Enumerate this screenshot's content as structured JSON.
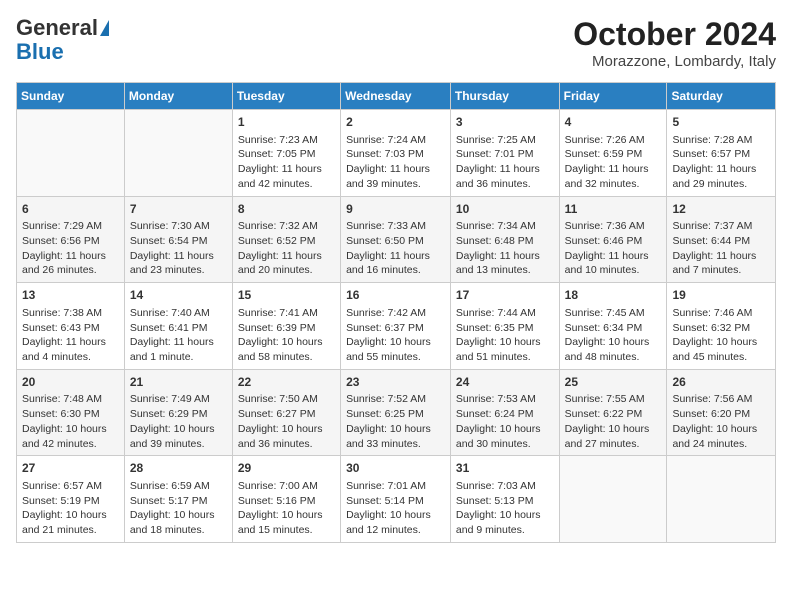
{
  "logo": {
    "line1": "General",
    "line2": "Blue"
  },
  "title": "October 2024",
  "subtitle": "Morazzone, Lombardy, Italy",
  "weekdays": [
    "Sunday",
    "Monday",
    "Tuesday",
    "Wednesday",
    "Thursday",
    "Friday",
    "Saturday"
  ],
  "weeks": [
    [
      {
        "day": "",
        "content": ""
      },
      {
        "day": "",
        "content": ""
      },
      {
        "day": "1",
        "content": "Sunrise: 7:23 AM\nSunset: 7:05 PM\nDaylight: 11 hours and 42 minutes."
      },
      {
        "day": "2",
        "content": "Sunrise: 7:24 AM\nSunset: 7:03 PM\nDaylight: 11 hours and 39 minutes."
      },
      {
        "day": "3",
        "content": "Sunrise: 7:25 AM\nSunset: 7:01 PM\nDaylight: 11 hours and 36 minutes."
      },
      {
        "day": "4",
        "content": "Sunrise: 7:26 AM\nSunset: 6:59 PM\nDaylight: 11 hours and 32 minutes."
      },
      {
        "day": "5",
        "content": "Sunrise: 7:28 AM\nSunset: 6:57 PM\nDaylight: 11 hours and 29 minutes."
      }
    ],
    [
      {
        "day": "6",
        "content": "Sunrise: 7:29 AM\nSunset: 6:56 PM\nDaylight: 11 hours and 26 minutes."
      },
      {
        "day": "7",
        "content": "Sunrise: 7:30 AM\nSunset: 6:54 PM\nDaylight: 11 hours and 23 minutes."
      },
      {
        "day": "8",
        "content": "Sunrise: 7:32 AM\nSunset: 6:52 PM\nDaylight: 11 hours and 20 minutes."
      },
      {
        "day": "9",
        "content": "Sunrise: 7:33 AM\nSunset: 6:50 PM\nDaylight: 11 hours and 16 minutes."
      },
      {
        "day": "10",
        "content": "Sunrise: 7:34 AM\nSunset: 6:48 PM\nDaylight: 11 hours and 13 minutes."
      },
      {
        "day": "11",
        "content": "Sunrise: 7:36 AM\nSunset: 6:46 PM\nDaylight: 11 hours and 10 minutes."
      },
      {
        "day": "12",
        "content": "Sunrise: 7:37 AM\nSunset: 6:44 PM\nDaylight: 11 hours and 7 minutes."
      }
    ],
    [
      {
        "day": "13",
        "content": "Sunrise: 7:38 AM\nSunset: 6:43 PM\nDaylight: 11 hours and 4 minutes."
      },
      {
        "day": "14",
        "content": "Sunrise: 7:40 AM\nSunset: 6:41 PM\nDaylight: 11 hours and 1 minute."
      },
      {
        "day": "15",
        "content": "Sunrise: 7:41 AM\nSunset: 6:39 PM\nDaylight: 10 hours and 58 minutes."
      },
      {
        "day": "16",
        "content": "Sunrise: 7:42 AM\nSunset: 6:37 PM\nDaylight: 10 hours and 55 minutes."
      },
      {
        "day": "17",
        "content": "Sunrise: 7:44 AM\nSunset: 6:35 PM\nDaylight: 10 hours and 51 minutes."
      },
      {
        "day": "18",
        "content": "Sunrise: 7:45 AM\nSunset: 6:34 PM\nDaylight: 10 hours and 48 minutes."
      },
      {
        "day": "19",
        "content": "Sunrise: 7:46 AM\nSunset: 6:32 PM\nDaylight: 10 hours and 45 minutes."
      }
    ],
    [
      {
        "day": "20",
        "content": "Sunrise: 7:48 AM\nSunset: 6:30 PM\nDaylight: 10 hours and 42 minutes."
      },
      {
        "day": "21",
        "content": "Sunrise: 7:49 AM\nSunset: 6:29 PM\nDaylight: 10 hours and 39 minutes."
      },
      {
        "day": "22",
        "content": "Sunrise: 7:50 AM\nSunset: 6:27 PM\nDaylight: 10 hours and 36 minutes."
      },
      {
        "day": "23",
        "content": "Sunrise: 7:52 AM\nSunset: 6:25 PM\nDaylight: 10 hours and 33 minutes."
      },
      {
        "day": "24",
        "content": "Sunrise: 7:53 AM\nSunset: 6:24 PM\nDaylight: 10 hours and 30 minutes."
      },
      {
        "day": "25",
        "content": "Sunrise: 7:55 AM\nSunset: 6:22 PM\nDaylight: 10 hours and 27 minutes."
      },
      {
        "day": "26",
        "content": "Sunrise: 7:56 AM\nSunset: 6:20 PM\nDaylight: 10 hours and 24 minutes."
      }
    ],
    [
      {
        "day": "27",
        "content": "Sunrise: 6:57 AM\nSunset: 5:19 PM\nDaylight: 10 hours and 21 minutes."
      },
      {
        "day": "28",
        "content": "Sunrise: 6:59 AM\nSunset: 5:17 PM\nDaylight: 10 hours and 18 minutes."
      },
      {
        "day": "29",
        "content": "Sunrise: 7:00 AM\nSunset: 5:16 PM\nDaylight: 10 hours and 15 minutes."
      },
      {
        "day": "30",
        "content": "Sunrise: 7:01 AM\nSunset: 5:14 PM\nDaylight: 10 hours and 12 minutes."
      },
      {
        "day": "31",
        "content": "Sunrise: 7:03 AM\nSunset: 5:13 PM\nDaylight: 10 hours and 9 minutes."
      },
      {
        "day": "",
        "content": ""
      },
      {
        "day": "",
        "content": ""
      }
    ]
  ]
}
